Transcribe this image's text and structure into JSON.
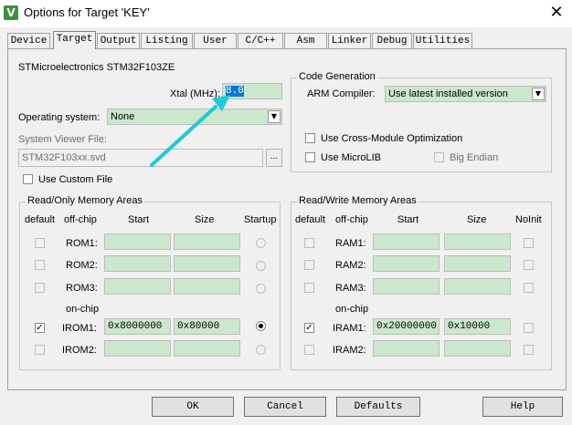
{
  "window": {
    "title": "Options for Target 'KEY'",
    "icon_letter": "V",
    "close_glyph": "✕"
  },
  "tabs": [
    "Device",
    "Target",
    "Output",
    "Listing",
    "User",
    "C/C++",
    "Asm",
    "Linker",
    "Debug",
    "Utilities"
  ],
  "device_name": "STMicroelectronics STM32F103ZE",
  "xtal": {
    "label": "Xtal (MHz):",
    "value": "8.0"
  },
  "os": {
    "label": "Operating system:",
    "value": "None"
  },
  "svd": {
    "label": "System Viewer File:",
    "value": "STM32F103xx.svd",
    "browse": "..."
  },
  "custom_file": {
    "label": "Use Custom File"
  },
  "codegen": {
    "title": "Code Generation",
    "compiler_label": "ARM Compiler:",
    "compiler_value": "Use latest installed version",
    "cross_module": "Use Cross-Module Optimization",
    "microlib": "Use MicroLIB",
    "big_endian": "Big Endian"
  },
  "rom": {
    "title": "Read/Only Memory Areas",
    "headers": {
      "default": "default",
      "offchip": "off-chip",
      "start": "Start",
      "size": "Size",
      "startup": "Startup"
    },
    "onchip_label": "on-chip",
    "rows": [
      {
        "name": "ROM1:",
        "start": "",
        "size": ""
      },
      {
        "name": "ROM2:",
        "start": "",
        "size": ""
      },
      {
        "name": "ROM3:",
        "start": "",
        "size": ""
      },
      {
        "name": "IROM1:",
        "start": "0x8000000",
        "size": "0x80000"
      },
      {
        "name": "IROM2:",
        "start": "",
        "size": ""
      }
    ]
  },
  "ram": {
    "title": "Read/Write Memory Areas",
    "headers": {
      "default": "default",
      "offchip": "off-chip",
      "start": "Start",
      "size": "Size",
      "noinit": "NoInit"
    },
    "onchip_label": "on-chip",
    "rows": [
      {
        "name": "RAM1:",
        "start": "",
        "size": ""
      },
      {
        "name": "RAM2:",
        "start": "",
        "size": ""
      },
      {
        "name": "RAM3:",
        "start": "",
        "size": ""
      },
      {
        "name": "IRAM1:",
        "start": "0x20000000",
        "size": "0x10000"
      },
      {
        "name": "IRAM2:",
        "start": "",
        "size": ""
      }
    ]
  },
  "buttons": {
    "ok": "OK",
    "cancel": "Cancel",
    "defaults": "Defaults",
    "help": "Help"
  },
  "check_glyph": "✓",
  "dropdown_glyph": "▼",
  "annotation_color": "#1fc9d8"
}
